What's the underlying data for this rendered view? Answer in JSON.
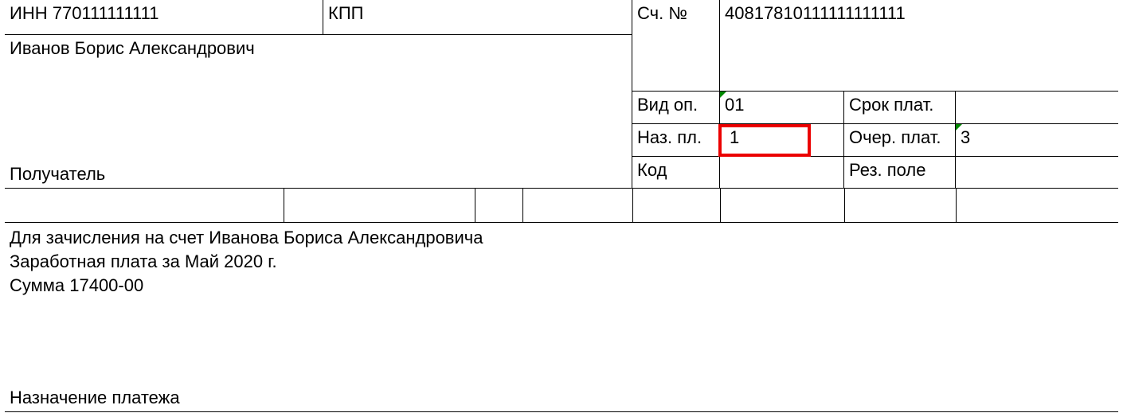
{
  "inn_label": "ИНН",
  "inn_value": "770111111111",
  "kpp_label": "КПП",
  "kpp_value": "",
  "account_label": "Сч. №",
  "account_value_part1": "40817810",
  "account_value_part2": "111111111111",
  "recipient_name": "Иванов Борис Александрович",
  "recipient_label": "Получатель",
  "vid_op_label": "Вид оп.",
  "vid_op_value": "01",
  "srok_plat_label": "Срок плат.",
  "srok_plat_value": "",
  "naz_pl_label": "Наз. пл.",
  "naz_pl_value": "1",
  "ocher_plat_label": "Очер. плат.",
  "ocher_plat_value": "3",
  "kod_label": "Код",
  "kod_value": "",
  "rez_pole_label": "Рез. поле",
  "rez_pole_value": "",
  "purpose_line1": "Для зачисления на счет Иванова Бориса Александровича",
  "purpose_line2": "Заработная плата за Май 2020 г.",
  "purpose_line3": "Сумма 17400-00",
  "purpose_label": "Назначение платежа"
}
